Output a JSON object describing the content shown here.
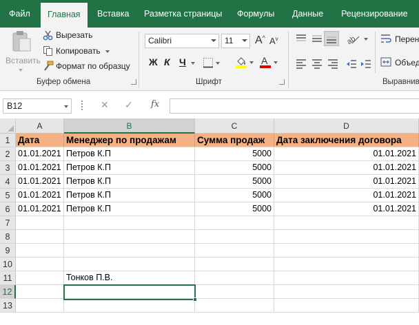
{
  "tabs": [
    "Файл",
    "Главная",
    "Вставка",
    "Разметка страницы",
    "Формулы",
    "Данные",
    "Рецензирование"
  ],
  "active_tab": "Главная",
  "clipboard": {
    "paste": "Вставить",
    "cut": "Вырезать",
    "copy": "Копировать",
    "format_painter": "Формат по образцу",
    "label": "Буфер обмена"
  },
  "font": {
    "name": "Calibri",
    "size": "11",
    "grow": "A",
    "shrink": "A",
    "bold": "Ж",
    "italic": "К",
    "underline": "Ч",
    "font_color_glyph": "A",
    "label": "Шрифт",
    "highlight_color": "#ffff00",
    "font_color": "#e00000"
  },
  "alignment": {
    "wrap": "Перен",
    "merge": "Объед",
    "label": "Выравнив"
  },
  "formula_bar": {
    "name_box": "B12",
    "cancel": "✕",
    "enter": "✓",
    "fx": "fx",
    "value": ""
  },
  "columns": [
    "A",
    "B",
    "C",
    "D"
  ],
  "rows": [
    "1",
    "2",
    "3",
    "4",
    "5",
    "6",
    "7",
    "8",
    "9",
    "10",
    "11",
    "12",
    "13"
  ],
  "table": {
    "headers": [
      "Дата",
      "Менеджер по продажам",
      "Сумма продаж",
      "Дата заключения договора"
    ],
    "data": [
      [
        "01.01.2021",
        "Петров К.П",
        "5000",
        "01.01.2021"
      ],
      [
        "01.01.2021",
        "Петров К.П",
        "5000",
        "01.01.2021"
      ],
      [
        "01.01.2021",
        "Петров К.П",
        "5000",
        "01.01.2021"
      ],
      [
        "01.01.2021",
        "Петров К.П",
        "5000",
        "01.01.2021"
      ],
      [
        "01.01.2021",
        "Петров К.П",
        "5000",
        "01.01.2021"
      ]
    ],
    "b11": "Тонков П.В."
  },
  "colors": {
    "excel_green": "#217346",
    "header_fill": "#f4b183"
  }
}
